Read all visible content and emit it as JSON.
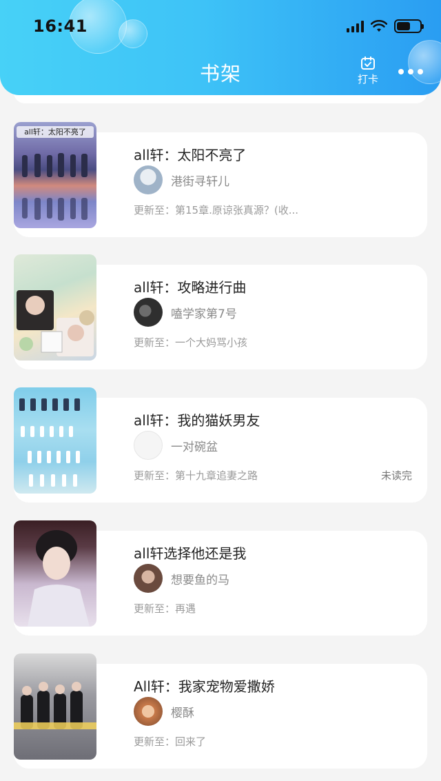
{
  "status_bar": {
    "time": "16:41"
  },
  "header": {
    "title": "书架",
    "checkin_label": "打卡"
  },
  "books": [
    {
      "title": "all轩：太阳不亮了",
      "author": "港街寻轩儿",
      "update": "更新至：第15章.原谅张真源？(收...",
      "cover_text": "all轩：太阳不亮了",
      "unread": "",
      "colors": {
        "cover": "#7d86c8",
        "avatar": "#9fb3c8"
      }
    },
    {
      "title": "all轩：攻略进行曲",
      "author": "嗑学家第7号",
      "update": "更新至：一个大妈骂小孩",
      "cover_text": "",
      "unread": "",
      "colors": {
        "cover": "#b9d8c7",
        "avatar": "#3b3b3b"
      }
    },
    {
      "title": "all轩：我的猫妖男友",
      "author": "一对碗盆",
      "update": "更新至：第十九章追妻之路",
      "cover_text": "",
      "unread": "未读完",
      "colors": {
        "cover": "#8fd0ea",
        "avatar": "#e8e8e8"
      }
    },
    {
      "title": "all轩选择他还是我",
      "author": "想要鱼的马",
      "update": "更新至：再遇",
      "cover_text": "",
      "unread": "",
      "colors": {
        "cover": "#d6c7d9",
        "avatar": "#6a4a3e"
      }
    },
    {
      "title": "All轩：我家宠物爱撒娇",
      "author": "樱酥",
      "update": "更新至：回来了",
      "cover_text": "",
      "unread": "",
      "colors": {
        "cover": "#8c8c92",
        "avatar": "#c97a4a"
      }
    }
  ]
}
